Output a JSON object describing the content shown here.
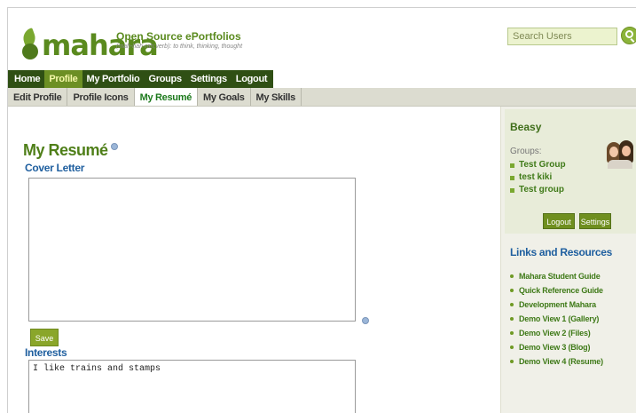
{
  "header": {
    "logo_word": "mahara",
    "tagline_title": "Open Source ePortfolios",
    "tagline_sub": "(mah-hah-rah;verb): to think, thinking, thought",
    "search_value": "Search Users"
  },
  "mainnav": [
    "Home",
    "Profile",
    "My Portfolio",
    "Groups",
    "Settings",
    "Logout"
  ],
  "mainnav_active": "Profile",
  "subnav": [
    "Edit Profile",
    "Profile Icons",
    "My Resumé",
    "My Goals",
    "My Skills"
  ],
  "subnav_active": "My Resumé",
  "page": {
    "title": "My Resumé",
    "cover_letter_label": "Cover Letter",
    "cover_letter_value": "",
    "save_label": "Save",
    "interests_label": "Interests",
    "interests_value": "I like trains and stamps"
  },
  "sidebar": {
    "username": "Beasy",
    "groups_label": "Groups:",
    "groups": [
      "Test Group",
      "test kiki",
      "Test group"
    ],
    "logout_label": "Logout",
    "settings_label": "Settings",
    "links_title": "Links and Resources",
    "links": [
      "Mahara Student Guide",
      "Quick Reference Guide",
      "Development Mahara",
      "Demo View 1 (Gallery)",
      "Demo View 2 (Files)",
      "Demo View 3 (Blog)",
      "Demo View 4 (Resume)"
    ]
  },
  "colors": {
    "brand_green": "#5a8a1e",
    "nav_dark": "#2f4f14",
    "nav_active": "#6c8f24",
    "heading_blue": "#1f5f9f",
    "button_green": "#8aa62a"
  }
}
